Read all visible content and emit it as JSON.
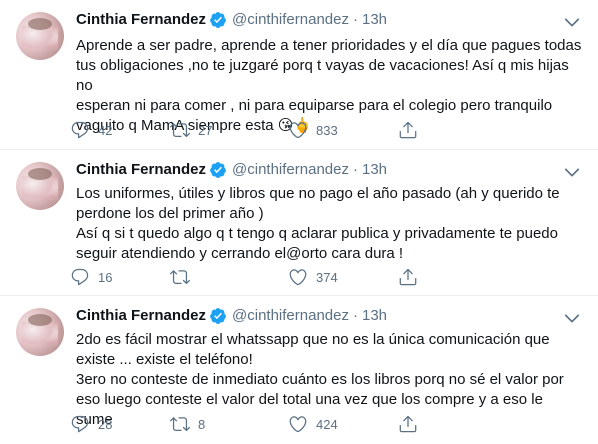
{
  "tweets": [
    {
      "name": "Cinthia Fernandez",
      "handle": "@cinthifernandez",
      "dot": "·",
      "time": "13h",
      "text": "Aprende a ser padre, aprende a tener prioridades y el día que pagues todas\ntus obligaciones ,no te juzgaré porq t vayas de vacaciones! Así q mis hijas no\nesperan ni para comer , ni para equiparse para el colegio pero tranquilo\nvaguito q MamA siempre esta 😘🖕",
      "replies": "42",
      "retweets": "27",
      "likes": "833"
    },
    {
      "name": "Cinthia Fernandez",
      "handle": "@cinthifernandez",
      "dot": "·",
      "time": "13h",
      "text": "Los uniformes, útiles y libros que no pago el año pasado (ah y querido te\nperdone los del primer año )\nAsí q si t quedo algo q t tengo q aclarar publica y privadamente te puedo\nseguir atendiendo y cerrando el@orto cara dura !",
      "replies": "16",
      "retweets": "",
      "likes": "374"
    },
    {
      "name": "Cinthia Fernandez",
      "handle": "@cinthifernandez",
      "dot": "·",
      "time": "13h",
      "text": "2do es fácil mostrar el whatssapp que no es la única comunicación que\nexiste ... existe el teléfono!\n3ero no conteste de inmediato cuánto es los libros porq no sé el valor por\neso luego conteste el valor del total una vez que los compre y a eso le sume",
      "replies": "28",
      "retweets": "8",
      "likes": "424"
    }
  ],
  "icons": {
    "verified": "verified-badge-icon",
    "caret": "chevron-down-icon",
    "reply": "reply-icon",
    "retweet": "retweet-icon",
    "like": "heart-icon",
    "share": "share-icon"
  },
  "colors": {
    "text": "#0f1419",
    "secondary": "#5b7083",
    "verified": "#1da1f2",
    "divider": "#ebeef0"
  }
}
